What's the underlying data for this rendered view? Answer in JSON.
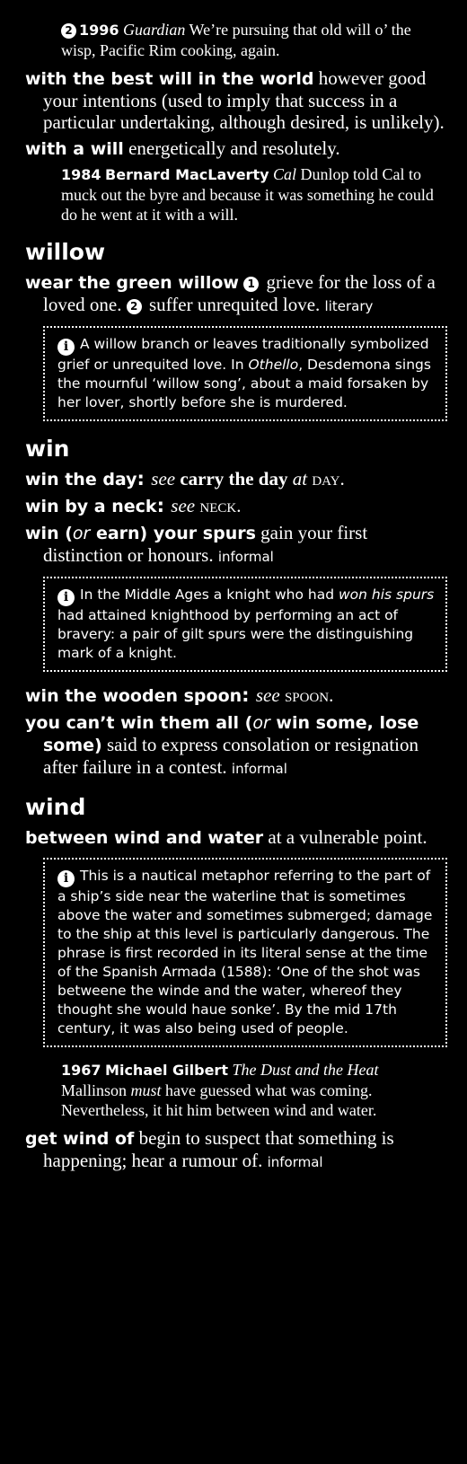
{
  "entries": [
    {
      "type": "quote",
      "num": "2",
      "year": "1996",
      "title": "Guardian",
      "text": " We’re pursuing that old will o’ the wisp, Pacific Rim cooking, again."
    },
    {
      "type": "entry",
      "head": "with the best will in the world",
      "def": " however good your intentions (used to imply that success in a particular undertaking, although desired, is unlikely)."
    },
    {
      "type": "entry",
      "head": "with a will",
      "def": " energetically and resolutely."
    },
    {
      "type": "quote",
      "year": "1984",
      "author": "Bernard MacLaverty",
      "title": "Cal",
      "text": " Dunlop told Cal to muck out the byre and because it was something he could do he went at it with a will."
    },
    {
      "type": "headword",
      "text": "willow"
    },
    {
      "type": "entry",
      "head": "wear the green willow",
      "n1": "1",
      "def1": " grieve for the loss of a loved one. ",
      "n2": "2",
      "def2": " suffer unrequited love. ",
      "register": "literary"
    },
    {
      "type": "info",
      "parts": [
        "A willow branch or leaves traditionally symbolized grief or unrequited love. In ",
        "Othello",
        ", Desdemona sings the mournful ‘willow song’, about a maid forsaken by her lover, shortly before she is murdered."
      ]
    },
    {
      "type": "headword",
      "text": "win"
    },
    {
      "type": "entry",
      "head": "win the day",
      "see": "see",
      "target": "carry the day",
      "at": "at",
      "ref": "day",
      "end": "."
    },
    {
      "type": "entry",
      "head": "win by a neck",
      "see": "see",
      "ref": "neck",
      "end": "."
    },
    {
      "type": "entry",
      "head1": "win (",
      "or": "or",
      "head2": " earn) your spurs",
      "def": " gain your first distinction or honours. ",
      "register": "informal"
    },
    {
      "type": "info",
      "parts": [
        "In the Middle Ages a knight who had ",
        "won his spurs",
        " had attained knighthood by performing an act of bravery: a pair of gilt spurs were the distinguishing mark of a knight."
      ]
    },
    {
      "type": "entry",
      "head": "win the wooden spoon",
      "see": "see",
      "ref": "spoon",
      "end": "."
    },
    {
      "type": "entry",
      "head1": "you can’t win them all (",
      "or": "or",
      "head2": " win some, lose some)",
      "def": " said to express consolation or resignation after failure in a contest. ",
      "register": "informal"
    },
    {
      "type": "headword",
      "text": "wind"
    },
    {
      "type": "entry",
      "head": "between wind and water",
      "def": " at a vulnerable point."
    },
    {
      "type": "info",
      "parts": [
        "This is a nautical metaphor referring to the part of a ship’s side near the waterline that is sometimes above the water and sometimes submerged; damage to the ship at this level is particularly dangerous. The phrase is first recorded in its literal sense at the time of the Spanish Armada (1588): ‘One of the shot was betweene the winde and the water, whereof they thought she would haue sonke’. By the mid 17th century, it was also being used of people."
      ]
    },
    {
      "type": "quote",
      "year": "1967",
      "author": "Michael Gilbert",
      "title": "The Dust and the Heat",
      "t1": " Mallinson ",
      "t2": "must",
      "t3": " have guessed what was coming. Nevertheless, it hit him between wind and water."
    },
    {
      "type": "entry",
      "head": "get wind of",
      "def": " begin to suspect that something is happening; hear a rumour of. ",
      "register": "informal"
    }
  ]
}
